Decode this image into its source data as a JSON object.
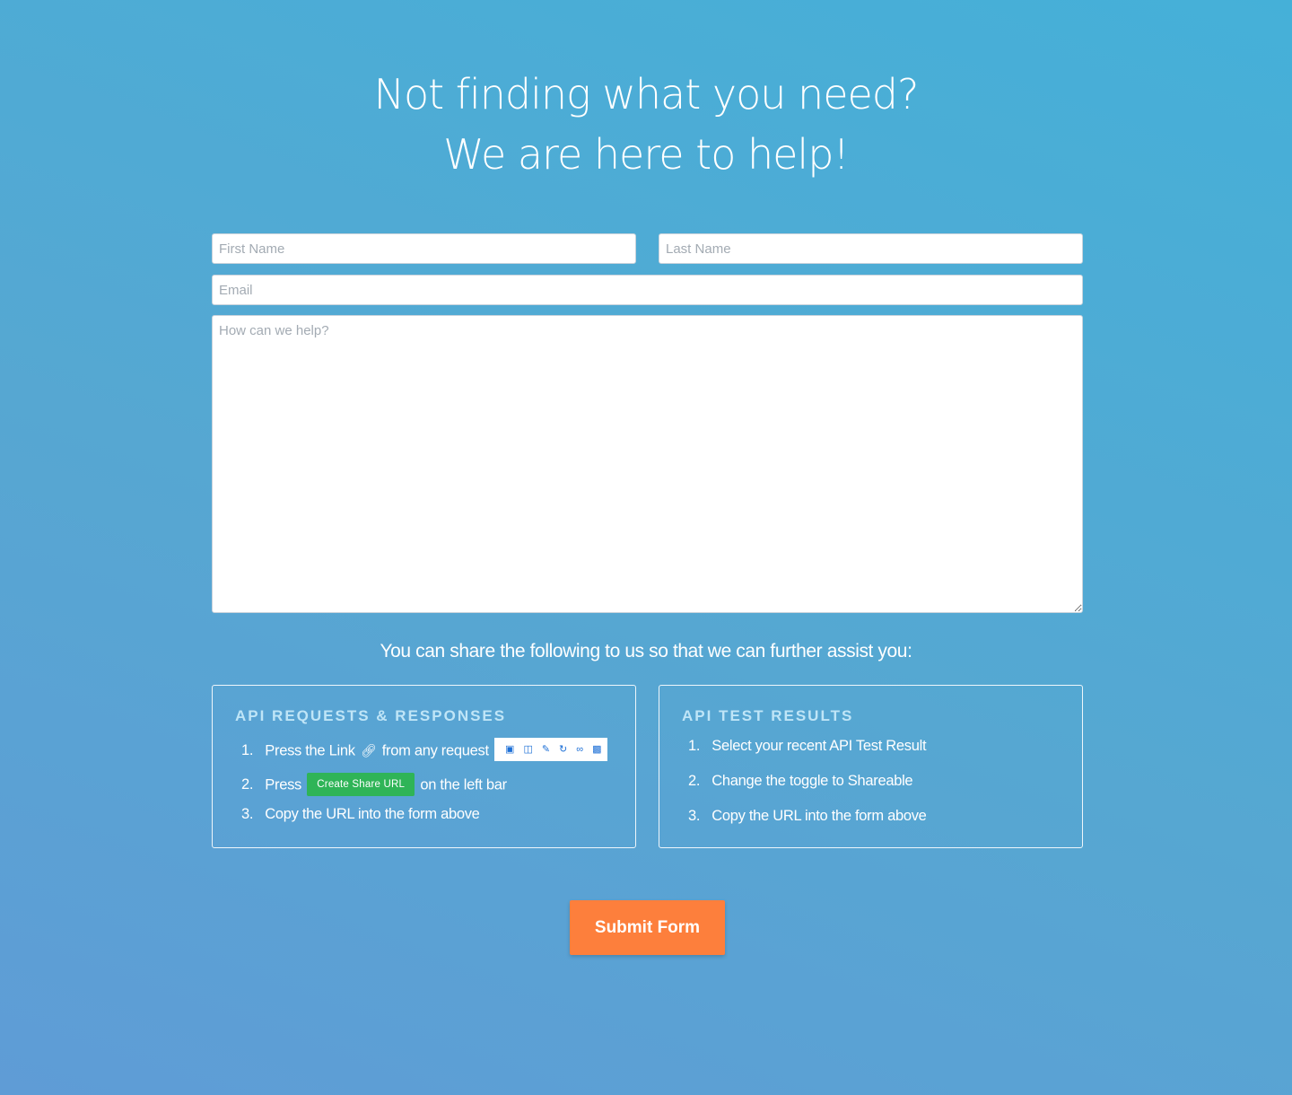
{
  "heading": {
    "line1": "Not finding what you need?",
    "line2": "We are here to help!"
  },
  "form": {
    "first_name_placeholder": "First Name",
    "last_name_placeholder": "Last Name",
    "email_placeholder": "Email",
    "message_placeholder": "How can we help?",
    "first_name_value": "",
    "last_name_value": "",
    "email_value": "",
    "message_value": ""
  },
  "share_intro": "You can share the following to us so that we can further assist you:",
  "cards": [
    {
      "title": "API REQUESTS & RESPONSES",
      "steps": [
        {
          "num": "1.",
          "before": "Press the Link",
          "after": "from any request"
        },
        {
          "num": "2.",
          "before": "Press",
          "button": "Create Share URL",
          "after": "on the left bar"
        },
        {
          "num": "3.",
          "text": "Copy the URL into the form above"
        }
      ],
      "toolbar_icons": [
        "folder-icon",
        "columns-icon",
        "pencil-icon",
        "refresh-icon",
        "link-icon",
        "trash-icon"
      ]
    },
    {
      "title": "API TEST RESULTS",
      "steps": [
        {
          "num": "1.",
          "text": "Select your recent API Test Result"
        },
        {
          "num": "2.",
          "text": "Change the toggle to Shareable"
        },
        {
          "num": "3.",
          "text": "Copy the URL into the form above"
        }
      ]
    }
  ],
  "submit_label": "Submit Form",
  "colors": {
    "submit": "#fd7f3c",
    "share_button": "#2fb457",
    "card_title": "#bfe5f7",
    "toolbar_icon": "#1c6fd6"
  }
}
